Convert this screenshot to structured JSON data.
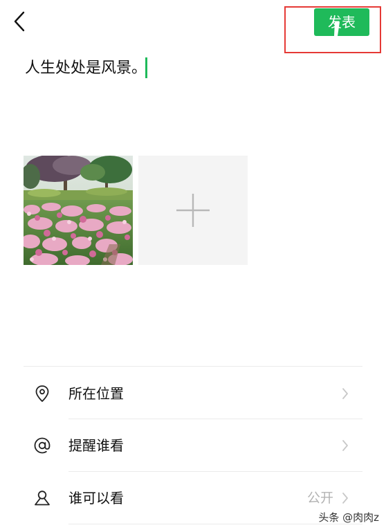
{
  "header": {
    "back_icon": "chevron-left-icon",
    "publish_label": "发表",
    "publish_color": "#1fba5a",
    "highlight_color": "#e53935"
  },
  "compose": {
    "text": "人生处处是风景。",
    "caret_color": "#1fba5a"
  },
  "photos": {
    "items": [
      {
        "icon": "photo-thumbnail"
      }
    ],
    "add_icon": "plus-icon"
  },
  "options": [
    {
      "label": "所在位置",
      "icon": "location-pin-icon",
      "value": ""
    },
    {
      "label": "提醒谁看",
      "icon": "at-sign-icon",
      "value": ""
    },
    {
      "label": "谁可以看",
      "icon": "person-icon",
      "value": "公开"
    }
  ],
  "watermark": {
    "text": "头条 @肉肉z"
  }
}
